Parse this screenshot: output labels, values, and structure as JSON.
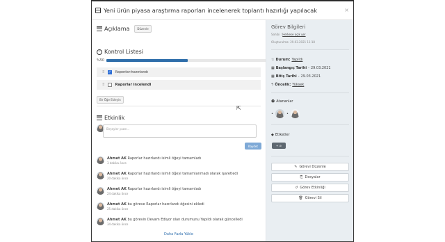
{
  "modal": {
    "title": "Yeni ürün piyasa araştırma raporları incelenerek toplantı hazırlığı yapılacak",
    "close": "×"
  },
  "description": {
    "heading": "Açıklama",
    "edit_button": "Düzenle"
  },
  "checklist": {
    "heading": "Kontrol Listesi",
    "progress_label": "%50",
    "progress": 0.5,
    "items": [
      {
        "label": "Raporlar hazırlandı",
        "checked": true
      },
      {
        "label": "Raporlar incelendi",
        "checked": false
      }
    ],
    "add_button": "Bir Öğe Ekleyin"
  },
  "activity": {
    "heading": "Etkinlik",
    "comment_placeholder": "Birşeyler yazın...",
    "save_button": "Kaydet",
    "entries": [
      {
        "user": "Ahmet AK",
        "text": "Raporlar hazırlandı isimli öğeyi tamamladı",
        "time": "3 dakika önce"
      },
      {
        "user": "Ahmet AK",
        "text": "Raporlar hazırlandı isimli öğeyi tamamlanmadı olarak işaretledi",
        "time": "20 dakika önce"
      },
      {
        "user": "Ahmet AK",
        "text": "Raporlar hazırlandı isimli öğeyi tamamladı",
        "time": "24 dakika önce"
      },
      {
        "user": "Ahmet AK",
        "text": "bu göreve Raporlar hazırlandı öğesini ekledi",
        "time": "25 dakika önce"
      },
      {
        "user": "Ahmet AK",
        "text": "bu görevin Devam Ediyor olan durumunu Yapıldı olarak güncelledi",
        "time": "34 dakika önce"
      }
    ],
    "load_more": "Daha Fazla Yükle"
  },
  "sidebar": {
    "title": "Görev Bilgileri",
    "owner_label": "Sahibi",
    "owner_value": "Herkese açık yer",
    "created_label": "Oluşturulma:",
    "created_value": "29.03.2021 11:18",
    "status_label": "Durum:",
    "status_value": "Yapıldı",
    "start_label": "Başlangıç Tarihi",
    "start_value": "29.03.2021",
    "end_label": "Bitiş Tarihi",
    "end_value": "29.03.2021",
    "priority_label": "Öncelik:",
    "priority_value": "Yüksek",
    "assignees_label": "Atananlar",
    "tags_label": "Etiketler",
    "tag_button": "+ ⊘",
    "buttons": {
      "edit": "Görevi Düzenle",
      "files": "Dosyalar",
      "activity": "Görev Etkinliği",
      "delete": "Görevi Sil"
    }
  },
  "colors": {
    "accent": "#2f6eaa",
    "save_button": "#7ea9d6",
    "sidebar_bg": "#e9eef2"
  }
}
